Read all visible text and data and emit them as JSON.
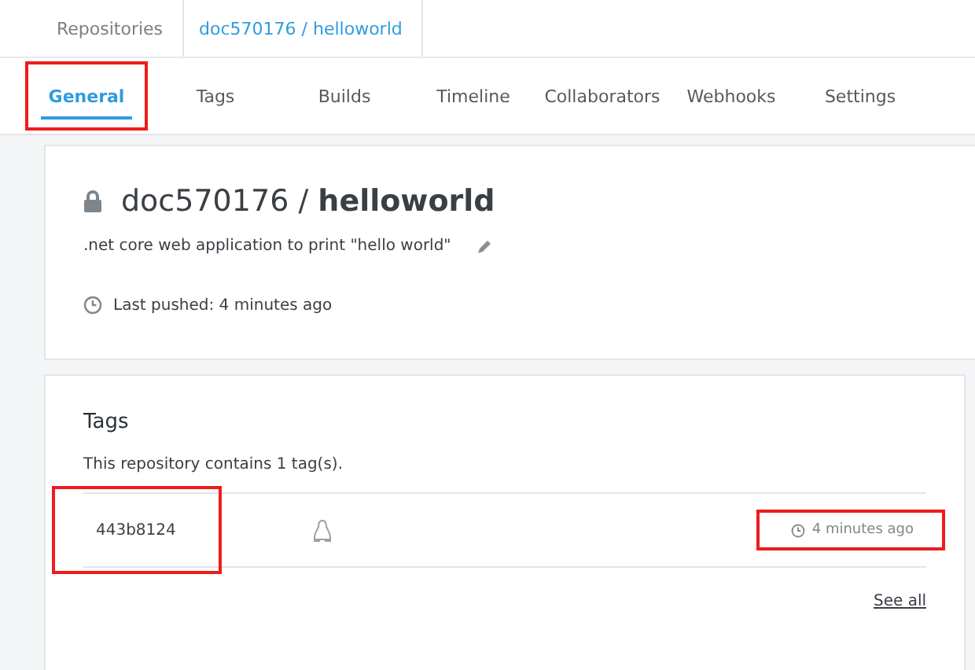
{
  "breadcrumb": [
    {
      "label": "Repositories",
      "selected": false
    },
    {
      "label": "doc570176 / helloworld",
      "selected": true
    }
  ],
  "tabs": [
    {
      "label": "General",
      "selected": true,
      "highlighted": true
    },
    {
      "label": "Tags",
      "selected": false,
      "highlighted": false
    },
    {
      "label": "Builds",
      "selected": false,
      "highlighted": false
    },
    {
      "label": "Timeline",
      "selected": false,
      "highlighted": false
    },
    {
      "label": "Collaborators",
      "selected": false,
      "highlighted": false
    },
    {
      "label": "Webhooks",
      "selected": false,
      "highlighted": false
    },
    {
      "label": "Settings",
      "selected": false,
      "highlighted": false
    }
  ],
  "repository": {
    "private": true,
    "namespace": "doc570176",
    "separator": "/",
    "name": "helloworld",
    "description": ".net core web application to print \"hello world\"",
    "last_pushed": "Last pushed: 4 minutes ago"
  },
  "tags_panel": {
    "title": "Tags",
    "summary": "This repository contains 1 tag(s).",
    "rows": [
      {
        "name": "443b8124",
        "name_highlighted": true,
        "time": "4 minutes ago",
        "time_highlighted": true
      }
    ],
    "see_all": "See all"
  }
}
